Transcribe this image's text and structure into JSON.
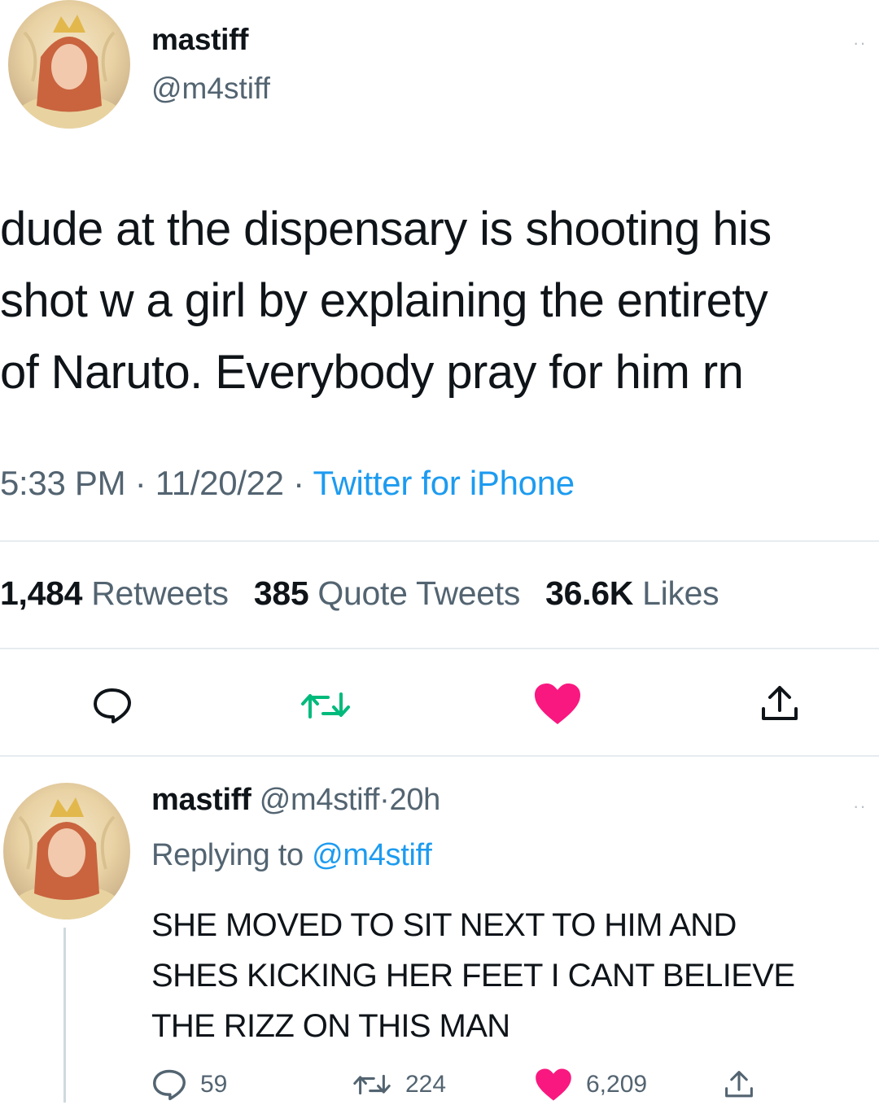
{
  "tweet": {
    "author": {
      "display_name": "mastiff",
      "handle": "@m4stiff"
    },
    "more_icon": "ellipsis-icon",
    "text": "dude at the dispensary is shooting his\nshot w a girl by explaining the entirety\nof Naruto. Everybody pray for him rn",
    "time": "5:33 PM",
    "date": "11/20/22",
    "separator": "·",
    "source": "Twitter for iPhone",
    "stats": {
      "retweets_count": "1,484",
      "retweets_label": "Retweets",
      "quotes_count": "385",
      "quotes_label": "Quote Tweets",
      "likes_count": "36.6K",
      "likes_label": "Likes"
    },
    "actions": [
      {
        "name": "reply",
        "icon": "comment-icon"
      },
      {
        "name": "retweet",
        "icon": "retweet-icon"
      },
      {
        "name": "like",
        "icon": "heart-icon",
        "active": true
      },
      {
        "name": "share",
        "icon": "share-icon"
      }
    ]
  },
  "reply": {
    "author": {
      "display_name": "mastiff",
      "handle": "@m4stiff"
    },
    "separator": "·",
    "time_ago": "20h",
    "replying_prefix": "Replying to",
    "replying_to": "@m4stiff",
    "text": "SHE MOVED TO SIT NEXT TO HIM AND\nSHES KICKING HER FEET I CANT BELIEVE\nTHE RIZZ ON THIS MAN",
    "counts": {
      "replies": "59",
      "retweets": "224",
      "likes": "6,209"
    }
  },
  "colors": {
    "text": "#0f1419",
    "secondary": "#536471",
    "link": "#1d9bf0",
    "like": "#f91880",
    "retweet": "#00ba7c",
    "divider": "#e6ecf0"
  }
}
